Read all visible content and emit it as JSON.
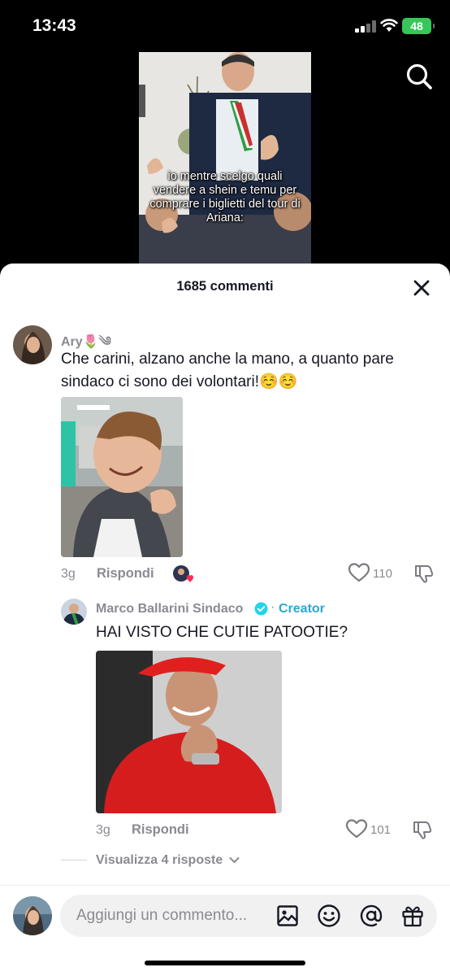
{
  "status_bar": {
    "time": "13:43",
    "battery": "48"
  },
  "video": {
    "caption": "io mentre  scelgo quali vendere a shein e temu per comprare i biglietti del tour di Ariana:"
  },
  "comments_header": {
    "title": "1685 commenti"
  },
  "comments": [
    {
      "username": "Ary🌷༄",
      "text": "Che carini, alzano anche la mano, a quanto pare sindaco ci sono dei volontari!☺️☺️",
      "time": "3g",
      "reply_label": "Rispondi",
      "likes": "110",
      "replies": [
        {
          "username": "Marco Ballarini Sindaco",
          "badge": "Creator",
          "text": "HAI VISTO CHE CUTIE PATOOTIE?",
          "time": "3g",
          "reply_label": "Rispondi",
          "likes": "101"
        }
      ],
      "view_replies_label": "Visualizza 4 risposte"
    }
  ],
  "composer": {
    "placeholder": "Aggiungi un commento..."
  },
  "colors": {
    "accent_blue": "#2aa8d8",
    "battery_green": "#35c759",
    "heart_red": "#fe2c55"
  },
  "icons": [
    "search-icon",
    "close-icon",
    "heart-icon",
    "dislike-icon",
    "image-icon",
    "emoji-icon",
    "mention-icon",
    "gift-icon",
    "verified-icon",
    "chevron-down-icon"
  ]
}
